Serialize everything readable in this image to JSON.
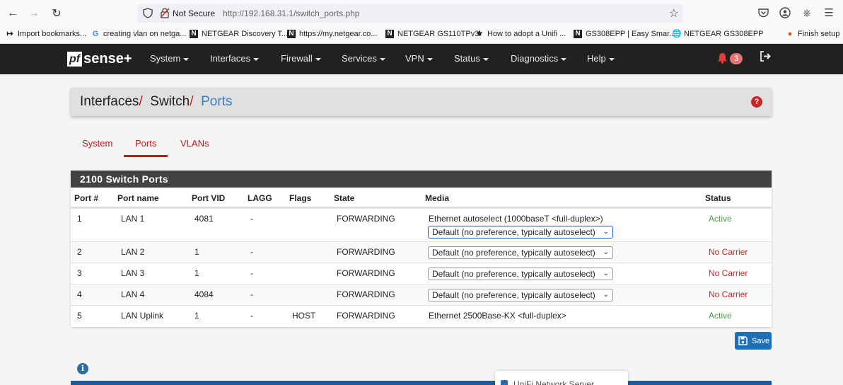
{
  "browser": {
    "security_label": "Not Secure",
    "url": "http://192.168.31.1/switch_ports.php",
    "bookmarks": [
      "Import bookmarks...",
      "creating vlan on netga...",
      "NETGEAR Discovery T...",
      "https://my.netgear.co...",
      "NETGEAR GS110TPv3",
      "How to adopt a Unifi ...",
      "GS308EPP | Easy Smar...",
      "NETGEAR GS308EPP",
      "Finish setup"
    ]
  },
  "navbar": {
    "logo_pf": "pf",
    "logo_sense": "sense+",
    "menu": [
      "System",
      "Interfaces",
      "Firewall",
      "Services",
      "VPN",
      "Status",
      "Diagnostics",
      "Help"
    ],
    "notification_count": "3"
  },
  "breadcrumb": {
    "items": [
      "Interfaces",
      "Switch",
      "Ports"
    ],
    "separator": "/",
    "help": "?"
  },
  "tabs": [
    "System",
    "Ports",
    "VLANs"
  ],
  "active_tab": "Ports",
  "panel": {
    "title": "2100 Switch Ports",
    "columns": [
      "Port #",
      "Port name",
      "Port VID",
      "LAGG",
      "Flags",
      "State",
      "Media",
      "Status"
    ],
    "rows": [
      {
        "port": "1",
        "name": "LAN 1",
        "vid": "4081",
        "lagg": "-",
        "flags": "",
        "state": "FORWARDING",
        "media_text": "Ethernet autoselect (1000baseT <full-duplex>)",
        "media_select": "Default (no preference, typically autoselect)",
        "status": "Active"
      },
      {
        "port": "2",
        "name": "LAN 2",
        "vid": "1",
        "lagg": "-",
        "flags": "",
        "state": "FORWARDING",
        "media_text": "",
        "media_select": "Default (no preference, typically autoselect)",
        "status": "No Carrier"
      },
      {
        "port": "3",
        "name": "LAN 3",
        "vid": "1",
        "lagg": "-",
        "flags": "",
        "state": "FORWARDING",
        "media_text": "",
        "media_select": "Default (no preference, typically autoselect)",
        "status": "No Carrier"
      },
      {
        "port": "4",
        "name": "LAN 4",
        "vid": "4084",
        "lagg": "-",
        "flags": "",
        "state": "FORWARDING",
        "media_text": "",
        "media_select": "Default (no preference, typically autoselect)",
        "status": "No Carrier"
      },
      {
        "port": "5",
        "name": "LAN Uplink",
        "vid": "1",
        "lagg": "-",
        "flags": "HOST",
        "state": "FORWARDING",
        "media_text": "Ethernet 2500Base-KX <full-duplex>",
        "media_select": "",
        "status": "Active"
      }
    ]
  },
  "save_label": "Save",
  "popup_text": "UniFi Network Server",
  "colors": {
    "navbar": "#212121",
    "accent_red": "#b71c1c",
    "breadcrumb_active": "#3a7ec2",
    "status_active": "#43a047",
    "status_no_carrier": "#c62828",
    "save_button": "#1e6fb8"
  }
}
